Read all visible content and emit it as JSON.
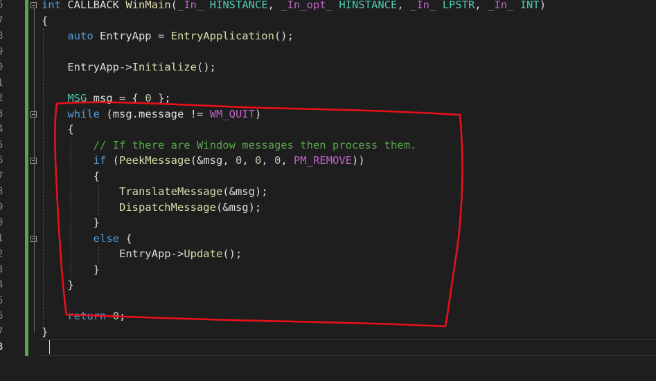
{
  "editor": {
    "line_numbers": [
      "6",
      "7",
      "8",
      "9",
      "0",
      "1",
      "2",
      "3",
      "4",
      "5",
      "6",
      "7",
      "8",
      "9",
      "0",
      "1",
      "2",
      "3",
      "4",
      "5",
      "6",
      "7",
      "8"
    ],
    "current_line_number": "8",
    "lines": [
      [
        {
          "t": "int",
          "c": "kw"
        },
        {
          "t": " CALLBACK ",
          "c": "plain"
        },
        {
          "t": "WinMain",
          "c": "fn"
        },
        {
          "t": "(",
          "c": "plain"
        },
        {
          "t": "_In_",
          "c": "macro"
        },
        {
          "t": " ",
          "c": "plain"
        },
        {
          "t": "HINSTANCE",
          "c": "type"
        },
        {
          "t": ", ",
          "c": "plain"
        },
        {
          "t": "_In_opt_",
          "c": "macro"
        },
        {
          "t": " ",
          "c": "plain"
        },
        {
          "t": "HINSTANCE",
          "c": "type"
        },
        {
          "t": ", ",
          "c": "plain"
        },
        {
          "t": "_In_",
          "c": "macro"
        },
        {
          "t": " ",
          "c": "plain"
        },
        {
          "t": "LPSTR",
          "c": "type"
        },
        {
          "t": ", ",
          "c": "plain"
        },
        {
          "t": "_In_",
          "c": "macro"
        },
        {
          "t": " ",
          "c": "plain"
        },
        {
          "t": "INT",
          "c": "type"
        },
        {
          "t": ")",
          "c": "plain"
        }
      ],
      [
        {
          "t": "{",
          "c": "plain"
        }
      ],
      [
        {
          "t": "    ",
          "c": "plain"
        },
        {
          "t": "auto",
          "c": "kw"
        },
        {
          "t": " EntryApp = ",
          "c": "plain"
        },
        {
          "t": "EntryApplication",
          "c": "fn"
        },
        {
          "t": "();",
          "c": "plain"
        }
      ],
      [],
      [
        {
          "t": "    EntryApp->",
          "c": "plain"
        },
        {
          "t": "Initialize",
          "c": "fn"
        },
        {
          "t": "();",
          "c": "plain"
        }
      ],
      [],
      [
        {
          "t": "    ",
          "c": "plain"
        },
        {
          "t": "MSG",
          "c": "type"
        },
        {
          "t": " msg = { ",
          "c": "plain"
        },
        {
          "t": "0",
          "c": "num"
        },
        {
          "t": " };",
          "c": "plain"
        }
      ],
      [
        {
          "t": "    ",
          "c": "plain"
        },
        {
          "t": "while",
          "c": "kw"
        },
        {
          "t": " (msg.message != ",
          "c": "plain"
        },
        {
          "t": "WM_QUIT",
          "c": "macro"
        },
        {
          "t": ")",
          "c": "plain"
        }
      ],
      [
        {
          "t": "    {",
          "c": "plain"
        }
      ],
      [
        {
          "t": "        ",
          "c": "plain"
        },
        {
          "t": "// If there are Window messages then process them.",
          "c": "cmt"
        }
      ],
      [
        {
          "t": "        ",
          "c": "plain"
        },
        {
          "t": "if",
          "c": "kw"
        },
        {
          "t": " (",
          "c": "plain"
        },
        {
          "t": "PeekMessage",
          "c": "fn"
        },
        {
          "t": "(&msg, ",
          "c": "plain"
        },
        {
          "t": "0",
          "c": "num"
        },
        {
          "t": ", ",
          "c": "plain"
        },
        {
          "t": "0",
          "c": "num"
        },
        {
          "t": ", ",
          "c": "plain"
        },
        {
          "t": "0",
          "c": "num"
        },
        {
          "t": ", ",
          "c": "plain"
        },
        {
          "t": "PM_REMOVE",
          "c": "macro"
        },
        {
          "t": "))",
          "c": "plain"
        }
      ],
      [
        {
          "t": "        {",
          "c": "plain"
        }
      ],
      [
        {
          "t": "            ",
          "c": "plain"
        },
        {
          "t": "TranslateMessage",
          "c": "fn"
        },
        {
          "t": "(&msg);",
          "c": "plain"
        }
      ],
      [
        {
          "t": "            ",
          "c": "plain"
        },
        {
          "t": "DispatchMessage",
          "c": "fn"
        },
        {
          "t": "(&msg);",
          "c": "plain"
        }
      ],
      [
        {
          "t": "        }",
          "c": "plain"
        }
      ],
      [
        {
          "t": "        ",
          "c": "plain"
        },
        {
          "t": "else",
          "c": "kw"
        },
        {
          "t": " {",
          "c": "plain"
        }
      ],
      [
        {
          "t": "            EntryApp->",
          "c": "plain"
        },
        {
          "t": "Update",
          "c": "fn"
        },
        {
          "t": "();",
          "c": "plain"
        }
      ],
      [
        {
          "t": "        }",
          "c": "plain"
        }
      ],
      [
        {
          "t": "    }",
          "c": "plain"
        }
      ],
      [],
      [
        {
          "t": "    ",
          "c": "plain"
        },
        {
          "t": "return",
          "c": "kw"
        },
        {
          "t": " ",
          "c": "plain"
        },
        {
          "t": "0",
          "c": "num"
        },
        {
          "t": ";",
          "c": "plain"
        }
      ],
      [
        {
          "t": "}",
          "c": "plain"
        }
      ]
    ]
  },
  "colors": {
    "background": "#1e1e1e",
    "keyword": "#569cd6",
    "type": "#4ec9b0",
    "function": "#dcdcaa",
    "macro": "#bd63c5",
    "comment": "#57a64a",
    "number": "#b5cea8",
    "text": "#dcdcdc",
    "change_bar": "#57a64a",
    "annotation": "#e8101a"
  },
  "annotation": {
    "shape": "hand-drawn-outline",
    "color": "#e8101a"
  }
}
